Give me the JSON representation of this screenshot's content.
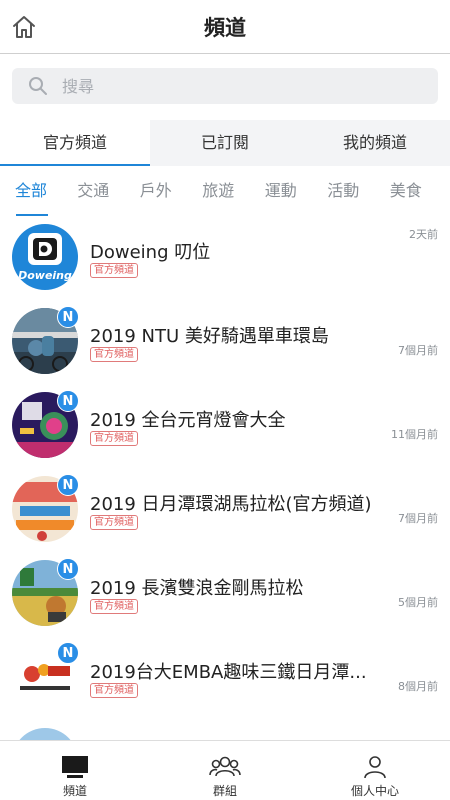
{
  "header": {
    "title": "頻道",
    "home_icon": "home-icon"
  },
  "search": {
    "placeholder": "搜尋",
    "value": ""
  },
  "tabs": [
    {
      "label": "官方頻道",
      "active": true
    },
    {
      "label": "已訂閱",
      "active": false
    },
    {
      "label": "我的頻道",
      "active": false
    }
  ],
  "categories": [
    {
      "label": "全部",
      "active": true
    },
    {
      "label": "交通",
      "active": false
    },
    {
      "label": "戶外",
      "active": false
    },
    {
      "label": "旅遊",
      "active": false
    },
    {
      "label": "運動",
      "active": false
    },
    {
      "label": "活動",
      "active": false
    },
    {
      "label": "美食",
      "active": false
    }
  ],
  "channels": [
    {
      "title": "Doweing 叨位",
      "tag": "官方頻道",
      "time": "2天前",
      "badge": "",
      "logo_text": "Doweing"
    },
    {
      "title": "2019 NTU 美好騎遇單車環島",
      "tag": "官方頻道",
      "time": "7個月前",
      "badge": "N"
    },
    {
      "title": "2019 全台元宵燈會大全",
      "tag": "官方頻道",
      "time": "11個月前",
      "badge": "N"
    },
    {
      "title": "2019 日月潭環湖馬拉松(官方頻道)",
      "tag": "官方頻道",
      "time": "7個月前",
      "badge": "N"
    },
    {
      "title": "2019 長濱雙浪金剛馬拉松",
      "tag": "官方頻道",
      "time": "5個月前",
      "badge": "N"
    },
    {
      "title": "2019台大EMBA趣味三鐵日月潭...",
      "tag": "官方頻道",
      "time": "8個月前",
      "badge": "N"
    }
  ],
  "bottom_nav": [
    {
      "label": "頻道",
      "icon": "tv-icon"
    },
    {
      "label": "群組",
      "icon": "group-icon"
    },
    {
      "label": "個人中心",
      "icon": "person-icon"
    }
  ],
  "colors": {
    "accent": "#1f86d8",
    "badge": "#2a8ee6",
    "tag": "#e06060"
  }
}
